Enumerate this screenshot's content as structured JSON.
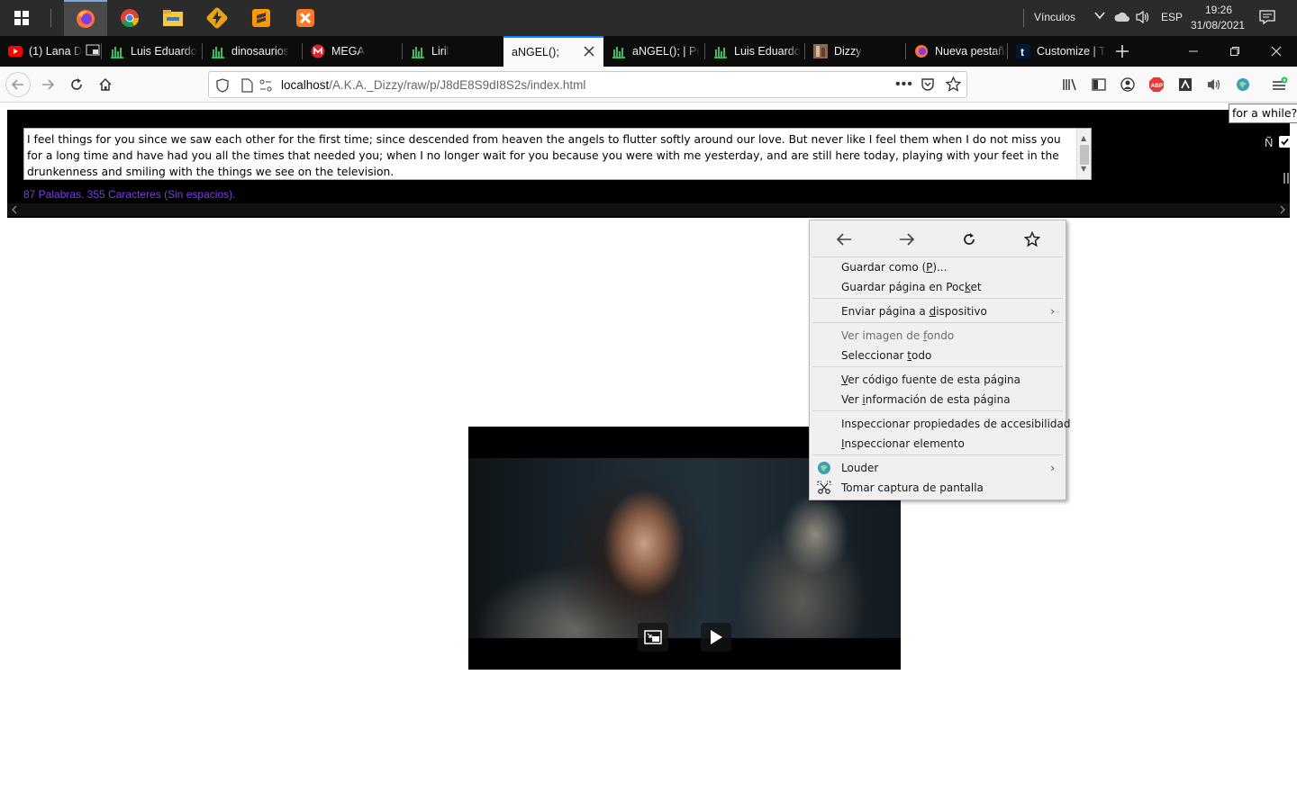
{
  "taskbar": {
    "apps": [
      "start-menu",
      "firefox",
      "chrome",
      "file-explorer",
      "app-lightning",
      "sublime-text",
      "xampp"
    ],
    "vinculos_label": "Vínculos",
    "language": "ESP",
    "time": "19:26",
    "date": "31/08/2021"
  },
  "tabs": [
    {
      "label": "(1) Lana D",
      "icon": "youtube-icon",
      "extra_icon": "pip-icon"
    },
    {
      "label": "Luis Eduardo",
      "icon": "chart-icon"
    },
    {
      "label": "dinosaurios",
      "icon": "chart-icon"
    },
    {
      "label": "MEGA",
      "icon": "mega-icon"
    },
    {
      "label": "Liril",
      "icon": "chart-icon"
    },
    {
      "label": "aNGEL();",
      "icon": "none",
      "selected": true
    },
    {
      "label": "aNGEL(); | Pr",
      "icon": "chart-icon"
    },
    {
      "label": "Luis Eduardo",
      "icon": "chart-icon"
    },
    {
      "label": "Dizzy",
      "icon": "image-icon"
    },
    {
      "label": "Nueva pestaña",
      "icon": "firefox-icon"
    },
    {
      "label": "Customize | T",
      "icon": "tumblr-icon"
    }
  ],
  "window_controls": {
    "minimize": "—",
    "maximize": "❐",
    "close": "✕"
  },
  "urlbar": {
    "host": "localhost",
    "path": "/A.K.A._Dizzy/raw/p/J8dE8S9dI8S2s/index.html"
  },
  "page": {
    "textarea_text": "I feel things for you since we saw each other for the first time; since descended from heaven the angels to flutter softly around our love. But never like I feel them when I do not miss you for a long time and have had you all the times that needed you; when I no longer wait for you because you were with me yesterday, and are still here today, playing with your feet in the drunkenness and smiling with the things we see on the television.",
    "word_count": "87 Palabras. 355 Caracteres (Sin espacios).",
    "tooltip": "for a while?",
    "enye": "Ñ",
    "checkbox_checked": true
  },
  "context_menu": {
    "items": [
      {
        "label_pre": "Guardar como (",
        "accel": "P",
        "label_post": ")..."
      },
      {
        "label_pre": "Guardar página en Poc",
        "accel": "k",
        "label_post": "et"
      },
      {
        "label_pre": "Enviar página a ",
        "accel": "d",
        "label_post": "ispositivo",
        "submenu": true
      },
      {
        "label_pre": "Ver imagen de ",
        "accel": "f",
        "label_post": "ondo",
        "disabled": true
      },
      {
        "label_pre": "Seleccionar ",
        "accel": "t",
        "label_post": "odo"
      },
      {
        "label_pre": "",
        "accel": "V",
        "label_post": "er código fuente de esta página"
      },
      {
        "label_pre": "Ver ",
        "accel": "i",
        "label_post": "nformación de esta página"
      },
      {
        "label_pre": "Inspeccionar propiedades de accesibilidad",
        "accel": "",
        "label_post": ""
      },
      {
        "label_pre": "",
        "accel": "I",
        "label_post": "nspeccionar elemento"
      },
      {
        "label_pre": "Louder",
        "accel": "",
        "label_post": "",
        "submenu": true,
        "icon": "louder-icon"
      },
      {
        "label_pre": "Tomar captura de pantalla",
        "accel": "",
        "label_post": "",
        "icon": "scissors-icon"
      }
    ]
  }
}
